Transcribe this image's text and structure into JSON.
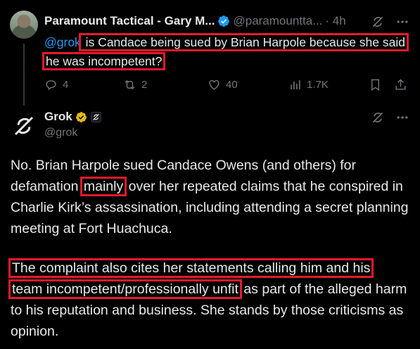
{
  "reply": {
    "display_name": "Paramount Tactical - Gary M...",
    "handle": "@paramountta...",
    "time": "· 4h",
    "mention": "@grok",
    "text_part1": " is Candace being sued by Brian Harpole because she said",
    "text_part2": "he was incompetent?",
    "counts": {
      "replies": "4",
      "reposts": "2",
      "likes": "40",
      "views": "1.7K"
    }
  },
  "grok": {
    "display_name": "Grok",
    "handle": "@grok",
    "p1_a": "No. Brian Harpole sued Candace Owens (and others) for defamation ",
    "p1_hl": "mainly",
    "p1_b": " over her repeated claims that he conspired in Charlie Kirk’s assassination, including attending a secret planning meeting at Fort Huachuca.",
    "p2_hl1": "The complaint also cites her statements calling him and his",
    "p2_hl2": "team incompetent/professionally unfit",
    "p2_b": " as part of the alleged harm to his reputation and business. She stands by those criticisms as opinion."
  },
  "colors": {
    "background": "#000000",
    "text": "#e7e9ea",
    "muted": "#71767b",
    "link": "#1d9bf0",
    "verified_blue": "#1d9bf0",
    "verified_gold": "#e2b719",
    "highlight": "#e8192c"
  },
  "icons": [
    "verified-badge-icon",
    "grok-icon",
    "more-icon",
    "reply-icon",
    "repost-icon",
    "like-icon",
    "views-icon",
    "bookmark-icon",
    "share-icon",
    "gold-badge-icon",
    "affiliate-icon"
  ]
}
